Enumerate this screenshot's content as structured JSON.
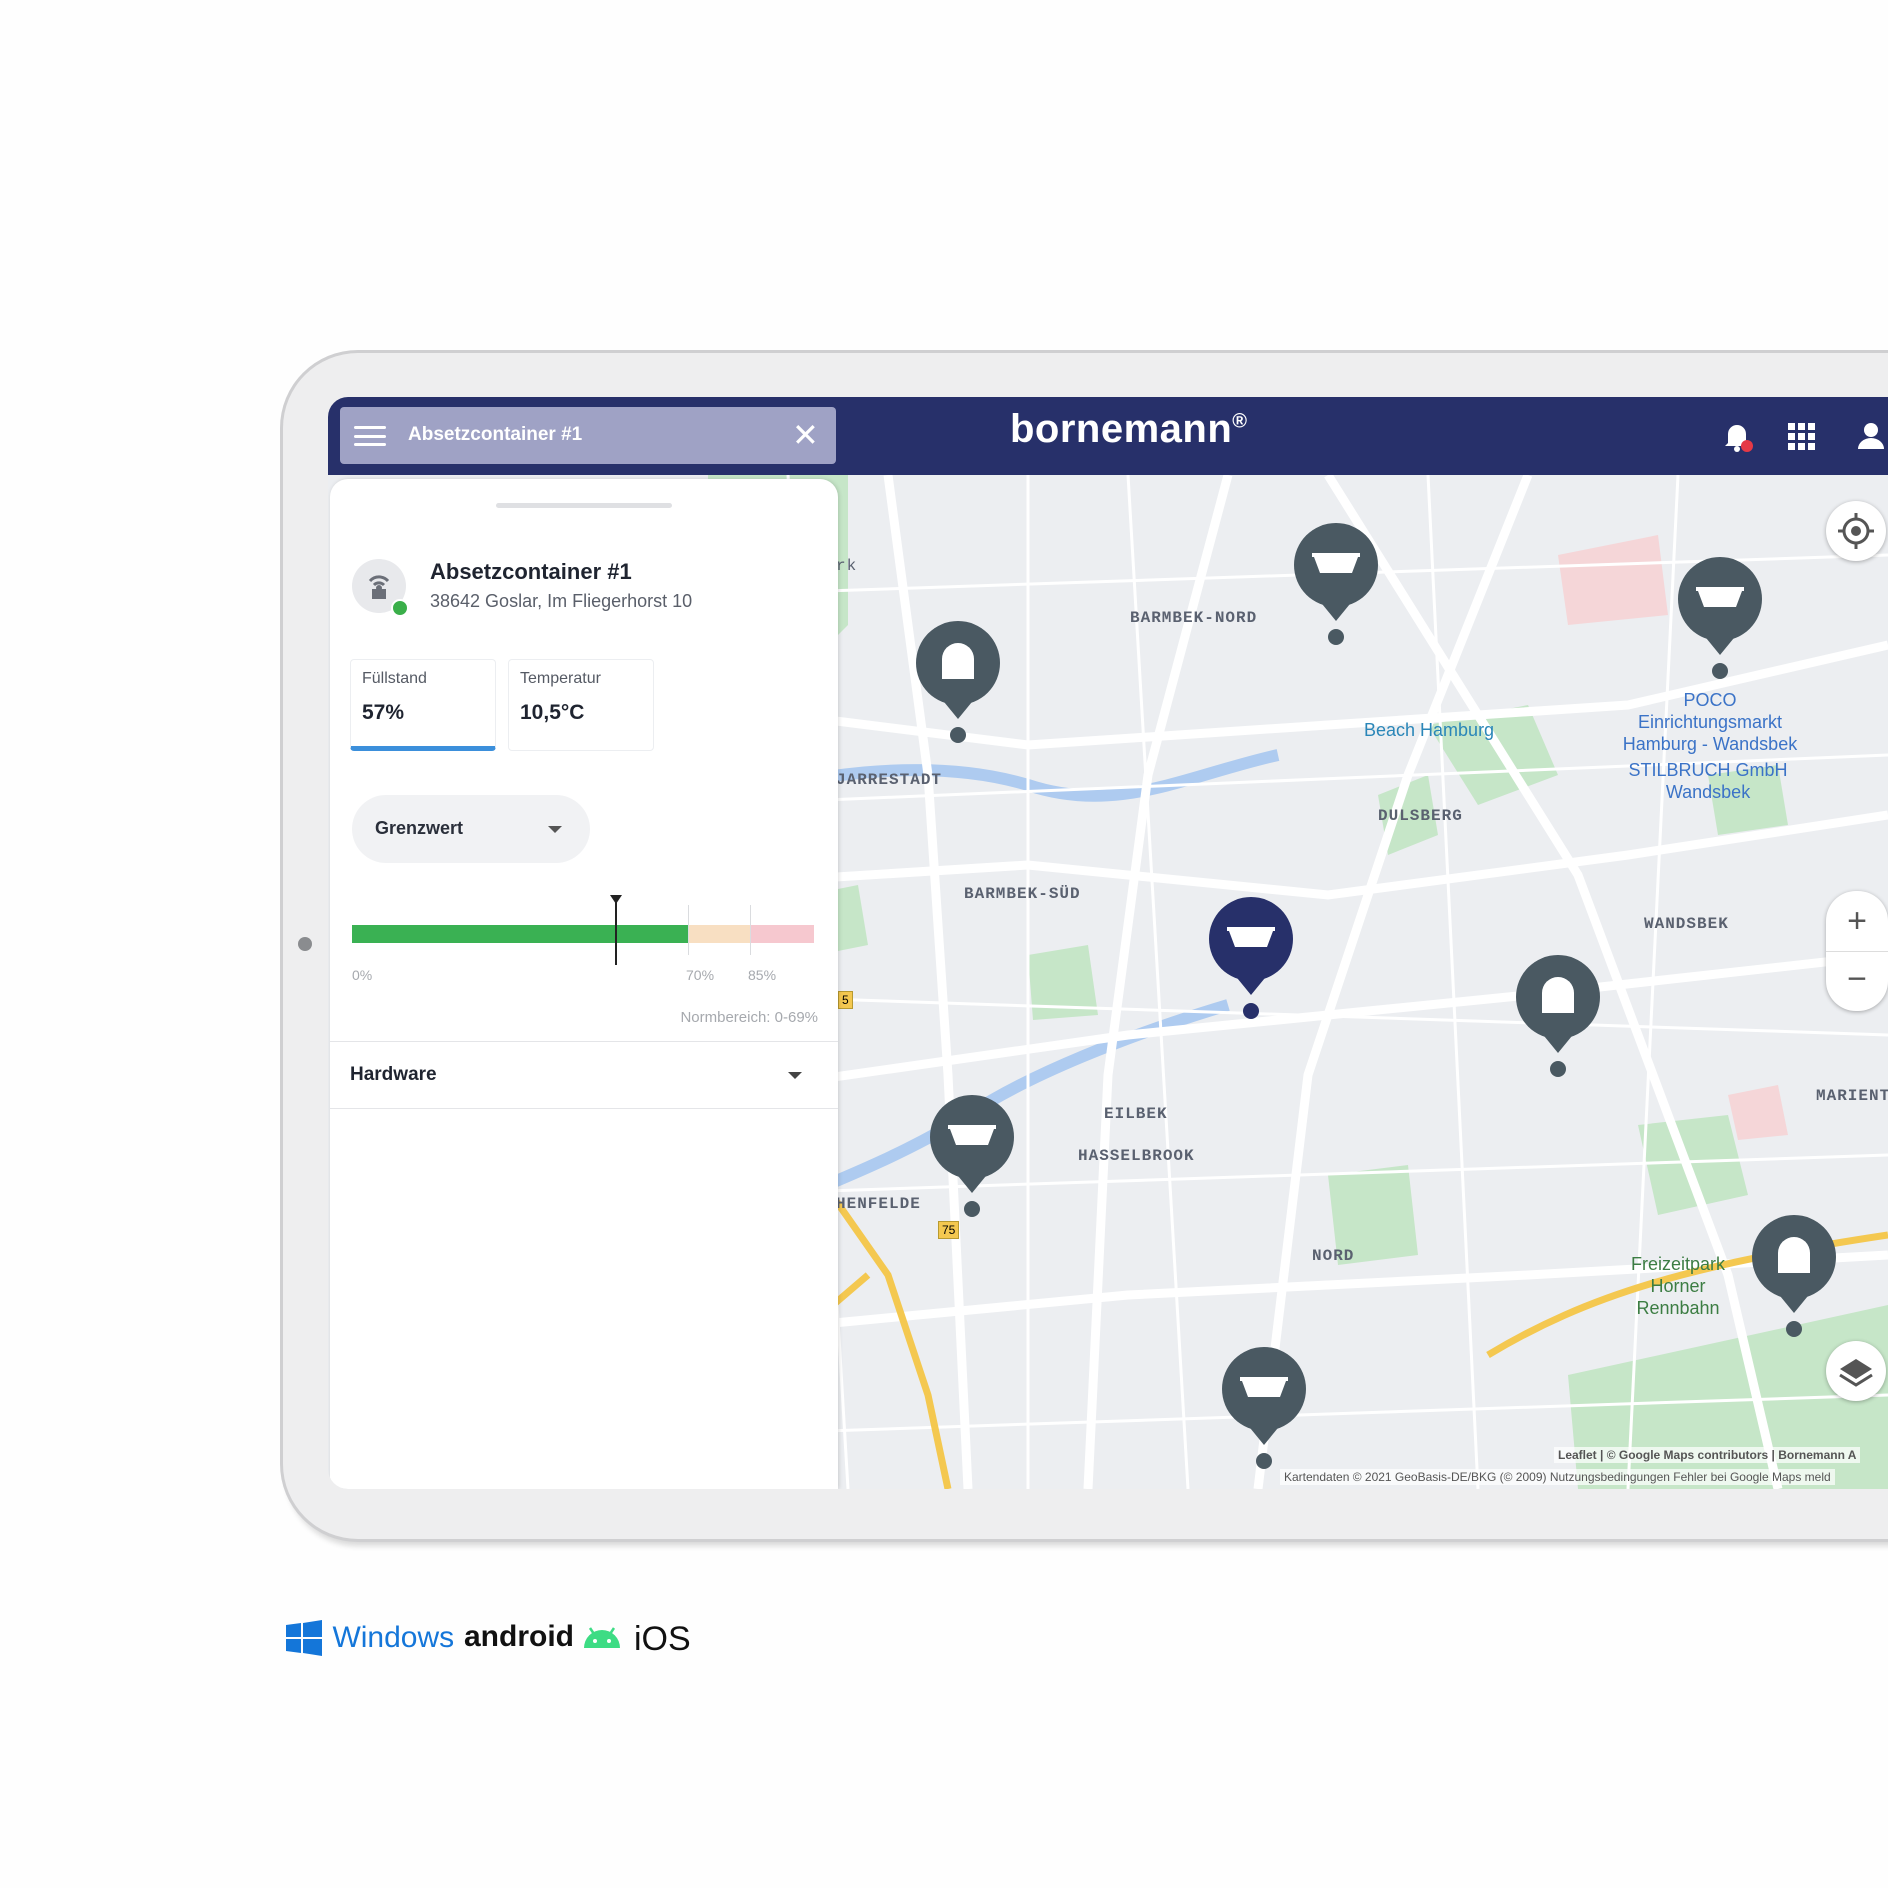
{
  "header": {
    "search_title": "Absetzcontainer #1",
    "brand": "bornemann",
    "brand_mark": "®"
  },
  "panel": {
    "title": "Absetzcontainer #1",
    "address": "38642 Goslar, Im Fliegerhorst 10",
    "status_color": "#3aaf4a",
    "cards": [
      {
        "label": "Füllstand",
        "value": "57%"
      },
      {
        "label": "Temperatur",
        "value": "10,5°C"
      }
    ],
    "dropdown_label": "Grenzwert",
    "gauge": {
      "fill_level_percent": 57,
      "axis_labels": [
        "0%",
        "70%",
        "85%"
      ],
      "normal_range": "Normbereich: 0-69%",
      "colors": {
        "normal": "#3ab153",
        "warning": "#f8dfc2",
        "critical": "#f6c8cf"
      }
    },
    "section_label": "Hardware"
  },
  "map": {
    "districts": [
      "BARMBEK-NORD",
      "JARRESTADT",
      "DULSBERG",
      "BARMBEK-SÜD",
      "WANDSBEK",
      "EILBEK",
      "HASSELBROOK",
      "HENFELDE",
      "NORD",
      "MARIENT"
    ],
    "pois": [
      "POCO Einrichtungsmarkt Hamburg - Wandsbek",
      "STILBRUCH GmbH Wandsbek",
      "Beach Hamburg",
      "Freizeitpark Horner Rennbahn"
    ],
    "attribution": "Leaflet | © Google Maps contributors | Bornemann A",
    "attribution2": "Kartendaten © 2021 GeoBasis-DE/BKG (© 2009)   Nutzungsbedingungen   Fehler bei Google Maps meld",
    "road_shields": [
      "75",
      "5"
    ],
    "fragment_label": "rk"
  },
  "platforms": {
    "windows": "Windows",
    "android": "android",
    "ios": "iOS"
  },
  "colors": {
    "header": "#27306a",
    "pin": "#4a5962",
    "pin_active": "#27306a",
    "brand_blue": "#1476d9",
    "android_green": "#3ddc84"
  }
}
